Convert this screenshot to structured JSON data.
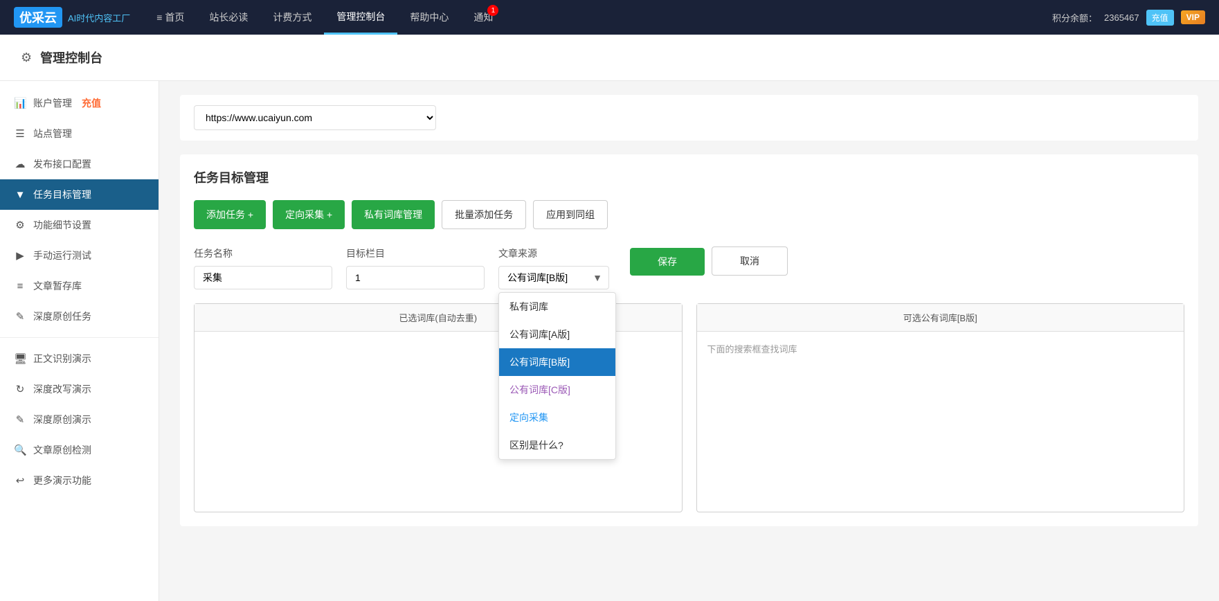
{
  "nav": {
    "logo_box": "优采云",
    "logo_tagline": "AI时代内容工厂",
    "items": [
      {
        "label": "≡ 首页",
        "active": false
      },
      {
        "label": "站长必读",
        "active": false
      },
      {
        "label": "计费方式",
        "active": false
      },
      {
        "label": "管理控制台",
        "active": true
      },
      {
        "label": "帮助中心",
        "active": false
      },
      {
        "label": "通知",
        "active": false
      }
    ],
    "notification_badge": "1",
    "points_label": "积分余额：",
    "points_value": "2365467",
    "recharge_label": "充值",
    "vip_label": "VIP"
  },
  "page_header": {
    "title": "管理控制台"
  },
  "sidebar": {
    "items": [
      {
        "icon": "📊",
        "label": "账户管理",
        "badge": "充值",
        "active": false,
        "id": "account"
      },
      {
        "icon": "☰",
        "label": "站点管理",
        "active": false,
        "id": "site"
      },
      {
        "icon": "☁",
        "label": "发布接口配置",
        "active": false,
        "id": "publish"
      },
      {
        "icon": "▼",
        "label": "任务目标管理",
        "active": true,
        "id": "task"
      },
      {
        "icon": "⚙",
        "label": "功能细节设置",
        "active": false,
        "id": "settings"
      },
      {
        "icon": "▶",
        "label": "手动运行测试",
        "active": false,
        "id": "manual"
      },
      {
        "icon": "≡",
        "label": "文章暂存库",
        "active": false,
        "id": "draft"
      },
      {
        "icon": "✎",
        "label": "深度原创任务",
        "active": false,
        "id": "deep-original"
      }
    ],
    "demo_items": [
      {
        "icon": "🖥",
        "label": "正文识别演示",
        "id": "demo-text"
      },
      {
        "icon": "↻",
        "label": "深度改写演示",
        "id": "demo-rewrite"
      },
      {
        "icon": "✎",
        "label": "深度原创演示",
        "id": "demo-original"
      },
      {
        "icon": "🔍",
        "label": "文章原创检测",
        "id": "demo-check"
      },
      {
        "icon": "↩",
        "label": "更多演示功能",
        "id": "demo-more"
      }
    ]
  },
  "url_selector": {
    "value": "https://www.ucaiyun.com",
    "options": [
      "https://www.ucaiyun.com"
    ]
  },
  "task_section": {
    "title": "任务目标管理",
    "buttons": {
      "add_task": "添加任务 +",
      "directed_collect": "定向采集 +",
      "private_library": "私有词库管理",
      "batch_add": "批量添加任务",
      "apply_group": "应用到同组"
    },
    "form": {
      "task_name_label": "任务名称",
      "task_name_value": "采集",
      "target_column_label": "目标栏目",
      "target_column_value": "1",
      "article_source_label": "文章来源",
      "article_source_value": "公有词库[B版]",
      "save_label": "保存",
      "cancel_label": "取消"
    },
    "dropdown": {
      "options": [
        {
          "label": "私有词库",
          "selected": false,
          "color": "normal"
        },
        {
          "label": "公有词库[A版]",
          "selected": false,
          "color": "normal"
        },
        {
          "label": "公有词库[B版]",
          "selected": true,
          "color": "normal"
        },
        {
          "label": "公有词库[C版]",
          "selected": false,
          "color": "purple"
        },
        {
          "label": "定向采集",
          "selected": false,
          "color": "blue"
        },
        {
          "label": "区别是什么?",
          "selected": false,
          "color": "normal"
        }
      ]
    },
    "panels": {
      "left_header": "已选词库(自动去重)",
      "right_header": "可选公有词库[B版]",
      "right_hint": "下面的搜索框查找词库"
    }
  }
}
